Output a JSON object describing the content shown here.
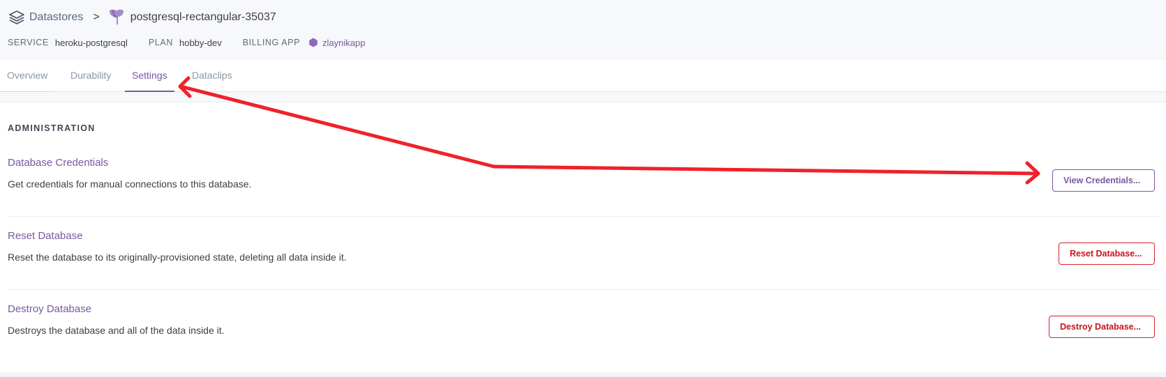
{
  "breadcrumb": {
    "root": "Datastores",
    "separator": ">",
    "current": "postgresql-rectangular-35037",
    "root_icon": "layers-stack-icon",
    "current_icon": "postgres-elephant-icon"
  },
  "meta": {
    "service_label": "SERVICE",
    "service_value": "heroku-postgresql",
    "plan_label": "PLAN",
    "plan_value": "hobby-dev",
    "billing_label": "BILLING APP",
    "billing_value": "zlaynikapp",
    "billing_icon": "hexagon-app-icon"
  },
  "tabs": [
    {
      "label": "Overview"
    },
    {
      "label": "Durability"
    },
    {
      "label": "Settings"
    },
    {
      "label": "Dataclips"
    }
  ],
  "active_tab": "Settings",
  "administration": {
    "heading": "ADMINISTRATION",
    "items": [
      {
        "title": "Database Credentials",
        "description": "Get credentials for manual connections to this database.",
        "button": "View Credentials..."
      },
      {
        "title": "Reset Database",
        "description": "Reset the database to its originally-provisioned state, deleting all data inside it.",
        "button": "Reset Database..."
      },
      {
        "title": "Destroy Database",
        "description": "Destroys the database and all of the data inside it.",
        "button": "Destroy Database..."
      }
    ]
  },
  "colors": {
    "accent": "#79589f",
    "danger": "#d9222b",
    "annotation_arrow": "#f0212b"
  }
}
